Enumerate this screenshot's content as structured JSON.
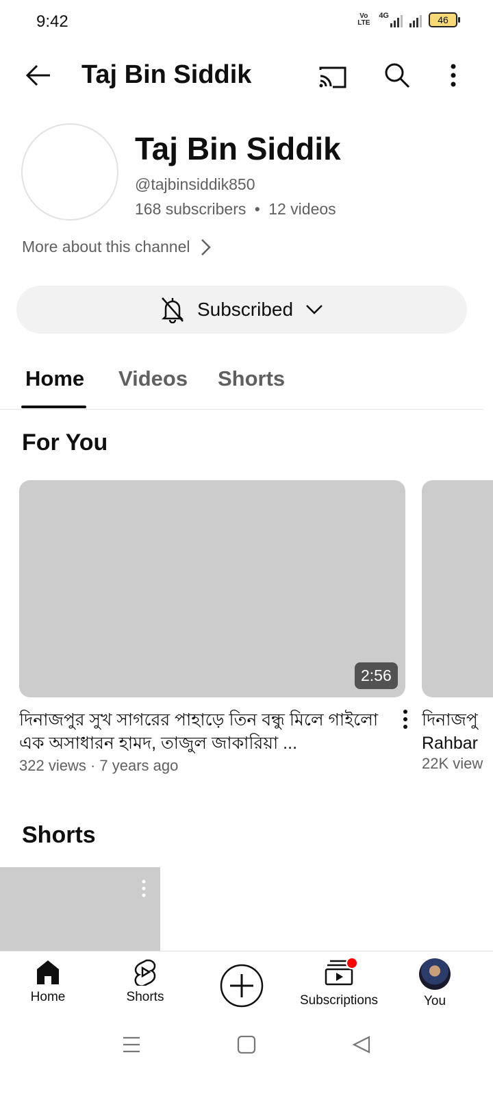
{
  "status_bar": {
    "time": "9:42",
    "volte_label": "Vo LTE",
    "network_label": "4G",
    "battery": "46",
    "battery_color": "#f7d978"
  },
  "header": {
    "title": "Taj Bin Siddik",
    "icons": [
      "back-arrow-icon",
      "cast-icon",
      "search-icon",
      "more-vert-icon"
    ]
  },
  "channel": {
    "name": "Taj Bin Siddik",
    "handle": "@tajbinsiddik850",
    "subscribers": "168 subscribers",
    "separator": "•",
    "videos": "12 videos",
    "more_about": "More about this channel",
    "subscribe_label": "Subscribed"
  },
  "tabs": [
    {
      "label": "Home",
      "active": true
    },
    {
      "label": "Videos",
      "active": false
    },
    {
      "label": "Shorts",
      "active": false
    }
  ],
  "for_you": {
    "title": "For You",
    "videos": [
      {
        "title": "দিনাজপুর সুখ সাগরের পাহাড়ে তিন বন্ধু মিলে গাইলো এক অসাধারন হামদ, তাজুল জাকারিয়া ...",
        "meta": "322 views · 7 years ago",
        "duration": "2:56"
      },
      {
        "title": "দিনাজপু",
        "title_line2": "Rahbar",
        "meta": "22K view"
      }
    ]
  },
  "shorts_section": {
    "title": "Shorts"
  },
  "bottom_nav": {
    "items": [
      {
        "label": "Home",
        "icon": "home-icon"
      },
      {
        "label": "Shorts",
        "icon": "shorts-icon"
      },
      {
        "label": "",
        "icon": "create-icon"
      },
      {
        "label": "Subscriptions",
        "icon": "subscriptions-icon"
      },
      {
        "label": "You",
        "icon": "avatar"
      }
    ],
    "notification_color": "#ff0000"
  }
}
